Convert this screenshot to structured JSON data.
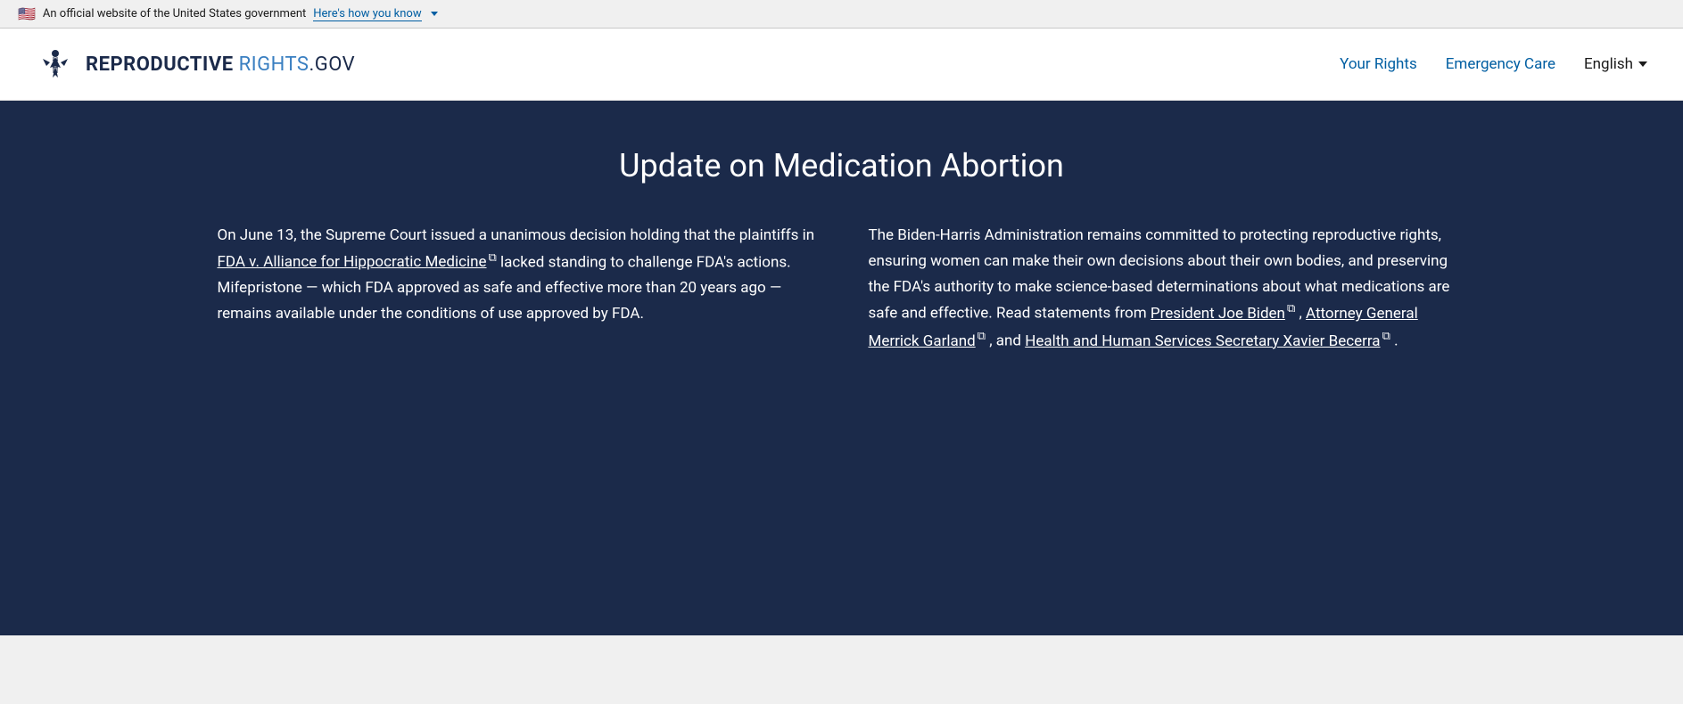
{
  "gov_banner": {
    "flag": "🇺🇸",
    "text": "An official website of the United States government",
    "link_text": "Here's how you know",
    "link_chevron": "▾"
  },
  "header": {
    "logo_text_bold": "REPRODUCTIVE",
    "logo_text_light": " RIGHTS",
    "logo_text_gov": ".GOV",
    "nav": {
      "your_rights": "Your Rights",
      "emergency_care": "Emergency Care",
      "language": "English"
    }
  },
  "hero": {
    "title": "Update on Medication Abortion",
    "col1": {
      "text_before_link": "On June 13, the Supreme Court issued a unanimous decision holding that the plaintiffs in ",
      "link1_text": "FDA v. Alliance for Hippocratic Medicine",
      "text_after_link": " lacked standing to challenge FDA's actions. Mifepristone — which FDA approved as safe and effective more than 20 years ago — remains available under the conditions of use approved by FDA."
    },
    "col2": {
      "text_intro": "The Biden-Harris Administration remains committed to protecting reproductive rights, ensuring women can make their own decisions about their own bodies, and preserving the FDA's authority to make science-based determinations about what medications are safe and effective. Read statements from ",
      "link1_text": "President Joe Biden",
      "text_separator1": " , ",
      "link2_text": "Attorney General Merrick Garland",
      "text_separator2": " , and ",
      "link3_text": "Health and Human Services Secretary Xavier Becerra",
      "text_end": " ."
    }
  }
}
